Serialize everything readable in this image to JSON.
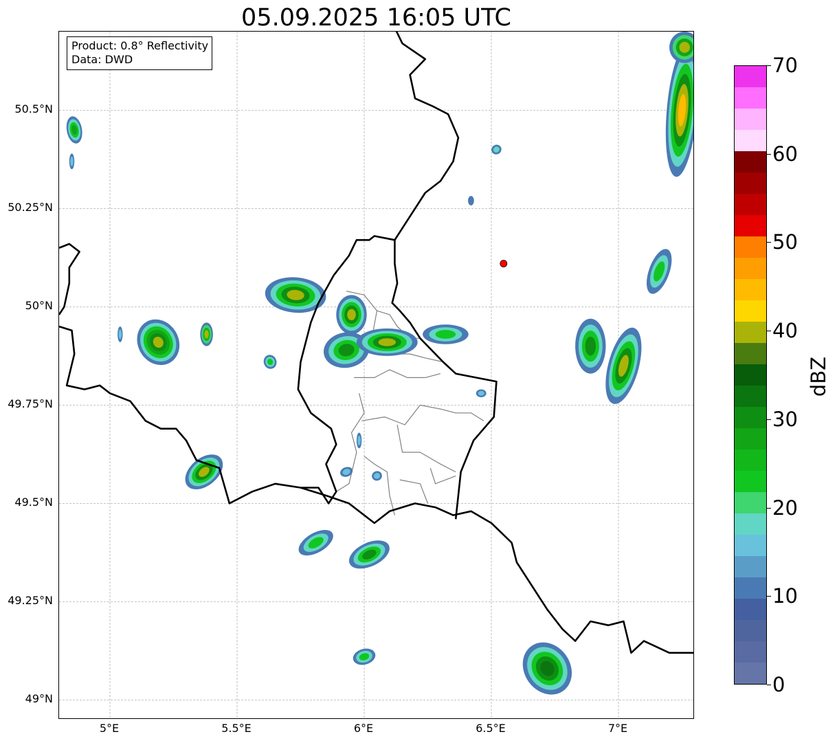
{
  "title": "05.09.2025 16:05 UTC",
  "product_box": {
    "product": "Product: 0.8° Reflectivity",
    "data_source": "Data: DWD"
  },
  "axes": {
    "lon_range": [
      4.8,
      7.3
    ],
    "lat_range": [
      48.95,
      50.7
    ],
    "lon_ticks": [
      {
        "value": 5.0,
        "label": "5°E"
      },
      {
        "value": 5.5,
        "label": "5.5°E"
      },
      {
        "value": 6.0,
        "label": "6°E"
      },
      {
        "value": 6.5,
        "label": "6.5°E"
      },
      {
        "value": 7.0,
        "label": "7°E"
      }
    ],
    "lat_ticks": [
      {
        "value": 50.5,
        "label": "50.5°N"
      },
      {
        "value": 50.25,
        "label": "50.25°N"
      },
      {
        "value": 50.0,
        "label": "50°N"
      },
      {
        "value": 49.75,
        "label": "49.75°N"
      },
      {
        "value": 49.5,
        "label": "49.5°N"
      },
      {
        "value": 49.25,
        "label": "49.25°N"
      },
      {
        "value": 49.0,
        "label": "49°N"
      }
    ],
    "grid": true
  },
  "colorbar": {
    "unit": "dBZ",
    "min": 0,
    "max": 70,
    "step": 2.5,
    "colors": [
      "#6575a8",
      "#5a6ba3",
      "#4f659e",
      "#4460a1",
      "#4a7ab4",
      "#5a9ec8",
      "#68c2dc",
      "#62d6c4",
      "#3fd56f",
      "#12c622",
      "#12b81a",
      "#12a516",
      "#0e8e12",
      "#0b7510",
      "#075d0a",
      "#4a7c10",
      "#aab408",
      "#ffd700",
      "#ffbb00",
      "#ff9e00",
      "#ff8000",
      "#e60000",
      "#c00000",
      "#a00000",
      "#800000",
      "#ffdcff",
      "#ffb4ff",
      "#ff6eff",
      "#ee33ee"
    ],
    "tick_labels": [
      {
        "value": 0,
        "label": "0"
      },
      {
        "value": 10,
        "label": "10"
      },
      {
        "value": 20,
        "label": "20"
      },
      {
        "value": 30,
        "label": "30"
      },
      {
        "value": 40,
        "label": "40"
      },
      {
        "value": 50,
        "label": "50"
      },
      {
        "value": 60,
        "label": "60"
      },
      {
        "value": 70,
        "label": "70"
      }
    ]
  },
  "radar_site": {
    "lon": 6.548,
    "lat": 50.11,
    "color": "#ff0000"
  },
  "colors": {
    "country_border": "#000000",
    "admin_border": "#808080",
    "grid": "#b0b0b0"
  },
  "borders": {
    "country": [
      [
        [
          4.8,
          50.15
        ],
        [
          4.84,
          50.16
        ],
        [
          4.88,
          50.14
        ],
        [
          4.84,
          50.1
        ],
        [
          4.84,
          50.06
        ],
        [
          4.82,
          50.0
        ],
        [
          4.8,
          49.98
        ]
      ],
      [
        [
          4.8,
          49.95
        ],
        [
          4.85,
          49.94
        ],
        [
          4.86,
          49.88
        ],
        [
          4.83,
          49.8
        ],
        [
          4.9,
          49.79
        ],
        [
          4.96,
          49.8
        ],
        [
          5.0,
          49.78
        ],
        [
          5.08,
          49.76
        ],
        [
          5.14,
          49.71
        ],
        [
          5.2,
          49.69
        ],
        [
          5.26,
          49.69
        ],
        [
          5.3,
          49.66
        ],
        [
          5.34,
          49.61
        ],
        [
          5.43,
          49.59
        ],
        [
          5.47,
          49.5
        ],
        [
          5.56,
          49.53
        ],
        [
          5.65,
          49.55
        ],
        [
          5.75,
          49.54
        ],
        [
          5.85,
          49.52
        ],
        [
          5.94,
          49.5
        ],
        [
          6.04,
          49.45
        ],
        [
          6.1,
          49.48
        ],
        [
          6.2,
          49.5
        ],
        [
          6.28,
          49.49
        ],
        [
          6.35,
          49.47
        ],
        [
          6.42,
          49.48
        ],
        [
          6.5,
          49.45
        ],
        [
          6.58,
          49.4
        ],
        [
          6.6,
          49.35
        ],
        [
          6.66,
          49.29
        ],
        [
          6.72,
          49.23
        ],
        [
          6.78,
          49.18
        ],
        [
          6.83,
          49.15
        ],
        [
          6.89,
          49.2
        ],
        [
          6.96,
          49.19
        ],
        [
          7.02,
          49.2
        ],
        [
          7.05,
          49.12
        ],
        [
          7.1,
          49.15
        ],
        [
          7.2,
          49.12
        ],
        [
          7.3,
          49.12
        ]
      ],
      [
        [
          6.12,
          50.71
        ],
        [
          6.15,
          50.67
        ],
        [
          6.24,
          50.63
        ],
        [
          6.18,
          50.59
        ],
        [
          6.2,
          50.53
        ],
        [
          6.27,
          50.51
        ],
        [
          6.33,
          50.49
        ],
        [
          6.37,
          50.43
        ],
        [
          6.35,
          50.37
        ],
        [
          6.3,
          50.32
        ],
        [
          6.24,
          50.29
        ],
        [
          6.17,
          50.22
        ],
        [
          6.12,
          50.17
        ],
        [
          6.12,
          50.11
        ],
        [
          6.13,
          50.06
        ],
        [
          6.11,
          50.01
        ],
        [
          6.14,
          49.99
        ],
        [
          6.18,
          49.96
        ],
        [
          6.22,
          49.92
        ],
        [
          6.31,
          49.86
        ],
        [
          6.36,
          49.83
        ],
        [
          6.44,
          49.82
        ],
        [
          6.52,
          49.81
        ],
        [
          6.51,
          49.72
        ],
        [
          6.43,
          49.66
        ],
        [
          6.38,
          49.58
        ],
        [
          6.36,
          49.46
        ]
      ],
      [
        [
          6.12,
          50.17
        ],
        [
          6.04,
          50.18
        ],
        [
          6.02,
          50.17
        ],
        [
          5.97,
          50.17
        ],
        [
          5.94,
          50.13
        ],
        [
          5.88,
          50.08
        ],
        [
          5.82,
          50.01
        ],
        [
          5.79,
          49.96
        ],
        [
          5.75,
          49.86
        ],
        [
          5.74,
          49.79
        ],
        [
          5.79,
          49.73
        ],
        [
          5.87,
          49.69
        ],
        [
          5.89,
          49.65
        ],
        [
          5.85,
          49.6
        ],
        [
          5.89,
          49.53
        ],
        [
          5.86,
          49.5
        ],
        [
          5.82,
          49.54
        ],
        [
          5.75,
          49.54
        ]
      ]
    ],
    "admin": [
      [
        [
          5.93,
          50.04
        ],
        [
          6.0,
          50.03
        ],
        [
          6.05,
          49.99
        ],
        [
          6.1,
          49.98
        ],
        [
          6.13,
          49.95
        ],
        [
          6.18,
          49.92
        ],
        [
          6.22,
          49.92
        ]
      ],
      [
        [
          6.05,
          49.99
        ],
        [
          6.03,
          49.92
        ],
        [
          6.1,
          49.88
        ],
        [
          6.18,
          49.88
        ],
        [
          6.24,
          49.87
        ],
        [
          6.31,
          49.86
        ]
      ],
      [
        [
          5.96,
          49.82
        ],
        [
          6.04,
          49.82
        ],
        [
          6.1,
          49.84
        ],
        [
          6.17,
          49.82
        ],
        [
          6.24,
          49.82
        ],
        [
          6.3,
          49.83
        ]
      ],
      [
        [
          5.98,
          49.78
        ],
        [
          6.0,
          49.73
        ],
        [
          5.95,
          49.68
        ],
        [
          5.97,
          49.63
        ],
        [
          5.94,
          49.55
        ],
        [
          5.89,
          49.53
        ]
      ],
      [
        [
          5.99,
          49.71
        ],
        [
          6.08,
          49.72
        ],
        [
          6.16,
          49.7
        ],
        [
          6.22,
          49.75
        ],
        [
          6.3,
          49.74
        ],
        [
          6.36,
          49.73
        ],
        [
          6.42,
          49.73
        ],
        [
          6.47,
          49.71
        ]
      ],
      [
        [
          6.13,
          49.7
        ],
        [
          6.15,
          49.63
        ],
        [
          6.22,
          49.63
        ],
        [
          6.3,
          49.6
        ],
        [
          6.36,
          49.58
        ]
      ],
      [
        [
          6.0,
          49.62
        ],
        [
          6.04,
          49.6
        ],
        [
          6.09,
          49.58
        ],
        [
          6.1,
          49.52
        ],
        [
          6.12,
          49.47
        ]
      ],
      [
        [
          6.14,
          49.56
        ],
        [
          6.22,
          49.55
        ],
        [
          6.25,
          49.5
        ]
      ],
      [
        [
          6.26,
          49.59
        ],
        [
          6.28,
          49.55
        ],
        [
          6.36,
          49.57
        ]
      ]
    ]
  },
  "echoes": [
    {
      "lon": 4.86,
      "lat": 50.45,
      "rlon": 0.03,
      "rlat": 0.035,
      "rot": -10,
      "levels": [
        12,
        18,
        24,
        28
      ]
    },
    {
      "lon": 4.85,
      "lat": 50.37,
      "rlon": 0.01,
      "rlat": 0.02,
      "rot": 0,
      "levels": [
        12,
        16
      ]
    },
    {
      "lon": 5.19,
      "lat": 49.91,
      "rlon": 0.08,
      "rlat": 0.06,
      "rot": -30,
      "levels": [
        10,
        18,
        24,
        28,
        32,
        40
      ]
    },
    {
      "lon": 5.04,
      "lat": 49.93,
      "rlon": 0.01,
      "rlat": 0.02,
      "rot": 0,
      "levels": [
        12,
        16
      ]
    },
    {
      "lon": 5.38,
      "lat": 49.93,
      "rlon": 0.025,
      "rlat": 0.03,
      "rot": 0,
      "levels": [
        12,
        20,
        26,
        40
      ]
    },
    {
      "lon": 5.37,
      "lat": 49.58,
      "rlon": 0.085,
      "rlat": 0.035,
      "rot": -40,
      "levels": [
        10,
        18,
        24,
        30,
        40
      ]
    },
    {
      "lon": 5.63,
      "lat": 49.86,
      "rlon": 0.025,
      "rlat": 0.018,
      "rot": -20,
      "levels": [
        12,
        18,
        24
      ]
    },
    {
      "lon": 5.73,
      "lat": 50.03,
      "rlon": 0.12,
      "rlat": 0.045,
      "rot": 5,
      "levels": [
        10,
        18,
        24,
        30,
        40
      ]
    },
    {
      "lon": 5.95,
      "lat": 49.98,
      "rlon": 0.06,
      "rlat": 0.05,
      "rot": 0,
      "levels": [
        10,
        18,
        24,
        30,
        40
      ]
    },
    {
      "lon": 5.93,
      "lat": 49.89,
      "rlon": 0.09,
      "rlat": 0.045,
      "rot": -10,
      "levels": [
        10,
        18,
        24,
        30
      ]
    },
    {
      "lon": 6.09,
      "lat": 49.91,
      "rlon": 0.12,
      "rlat": 0.035,
      "rot": 0,
      "levels": [
        10,
        18,
        24,
        30,
        40
      ]
    },
    {
      "lon": 6.32,
      "lat": 49.93,
      "rlon": 0.09,
      "rlat": 0.025,
      "rot": 0,
      "levels": [
        10,
        18,
        24
      ]
    },
    {
      "lon": 6.52,
      "lat": 50.4,
      "rlon": 0.02,
      "rlat": 0.012,
      "rot": -30,
      "levels": [
        12,
        18
      ]
    },
    {
      "lon": 6.42,
      "lat": 50.27,
      "rlon": 0.012,
      "rlat": 0.012,
      "rot": 0,
      "levels": [
        12
      ]
    },
    {
      "lon": 6.46,
      "lat": 49.78,
      "rlon": 0.02,
      "rlat": 0.01,
      "rot": 0,
      "levels": [
        12,
        16
      ]
    },
    {
      "lon": 5.98,
      "lat": 49.66,
      "rlon": 0.01,
      "rlat": 0.02,
      "rot": 0,
      "levels": [
        12,
        16
      ]
    },
    {
      "lon": 5.93,
      "lat": 49.58,
      "rlon": 0.025,
      "rlat": 0.012,
      "rot": -20,
      "levels": [
        12,
        16
      ]
    },
    {
      "lon": 6.05,
      "lat": 49.57,
      "rlon": 0.02,
      "rlat": 0.012,
      "rot": -20,
      "levels": [
        12,
        16
      ]
    },
    {
      "lon": 5.81,
      "lat": 49.4,
      "rlon": 0.075,
      "rlat": 0.025,
      "rot": -30,
      "levels": [
        12,
        18,
        24
      ]
    },
    {
      "lon": 6.02,
      "lat": 49.37,
      "rlon": 0.085,
      "rlat": 0.03,
      "rot": -25,
      "levels": [
        10,
        18,
        24,
        30
      ]
    },
    {
      "lon": 6.0,
      "lat": 49.11,
      "rlon": 0.045,
      "rlat": 0.02,
      "rot": -15,
      "levels": [
        12,
        18,
        24
      ]
    },
    {
      "lon": 6.72,
      "lat": 49.08,
      "rlon": 0.09,
      "rlat": 0.07,
      "rot": -35,
      "levels": [
        10,
        18,
        24,
        30,
        34
      ]
    },
    {
      "lon": 7.16,
      "lat": 50.09,
      "rlon": 0.04,
      "rlat": 0.06,
      "rot": 20,
      "levels": [
        12,
        18,
        24
      ]
    },
    {
      "lon": 6.89,
      "lat": 49.9,
      "rlon": 0.06,
      "rlat": 0.07,
      "rot": 0,
      "levels": [
        10,
        18,
        24,
        30
      ]
    },
    {
      "lon": 7.02,
      "lat": 49.85,
      "rlon": 0.06,
      "rlat": 0.1,
      "rot": 15,
      "levels": [
        10,
        18,
        24,
        30,
        40
      ]
    },
    {
      "lon": 7.25,
      "lat": 50.5,
      "rlon": 0.06,
      "rlat": 0.17,
      "rot": 5,
      "levels": [
        10,
        18,
        24,
        30,
        40,
        46
      ]
    },
    {
      "lon": 7.26,
      "lat": 50.66,
      "rlon": 0.06,
      "rlat": 0.04,
      "rot": 0,
      "levels": [
        12,
        20,
        28,
        40
      ]
    }
  ]
}
